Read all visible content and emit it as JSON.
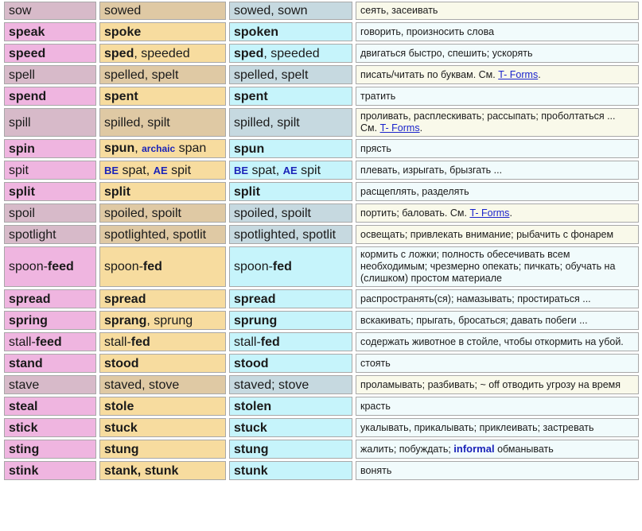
{
  "rows": [
    {
      "type": "weak",
      "h": 23,
      "base": [
        {
          "t": "sow"
        }
      ],
      "past": [
        {
          "t": "sowed"
        }
      ],
      "pp": [
        {
          "t": "sowed, sown"
        }
      ],
      "tr": [
        {
          "t": "сеять, засеивать"
        }
      ]
    },
    {
      "type": "strong",
      "h": 24,
      "base": [
        {
          "t": "speak",
          "b": true
        }
      ],
      "past": [
        {
          "t": "spoke",
          "b": true
        }
      ],
      "pp": [
        {
          "t": "spoken",
          "b": true
        }
      ],
      "tr": [
        {
          "t": "говорить, произносить слова"
        }
      ]
    },
    {
      "type": "strong",
      "h": 24,
      "base": [
        {
          "t": "speed",
          "b": true
        }
      ],
      "past": [
        {
          "t": "sped",
          "b": true
        },
        {
          "t": ", speeded"
        }
      ],
      "pp": [
        {
          "t": "sped",
          "b": true
        },
        {
          "t": ", speeded"
        }
      ],
      "tr": [
        {
          "t": "двигаться быстро, спешить; ускорять"
        }
      ]
    },
    {
      "type": "weak",
      "h": 24,
      "base": [
        {
          "t": "spell"
        }
      ],
      "past": [
        {
          "t": "spelled, spelt"
        }
      ],
      "pp": [
        {
          "t": "spelled, spelt"
        }
      ],
      "tr": [
        {
          "t": "писать/читать по буквам. См. "
        },
        {
          "t": "T- Forms",
          "link": true
        },
        {
          "t": "."
        }
      ]
    },
    {
      "type": "strong",
      "h": 24,
      "base": [
        {
          "t": "spend",
          "b": true
        }
      ],
      "past": [
        {
          "t": "spent",
          "b": true
        }
      ],
      "pp": [
        {
          "t": "spent",
          "b": true
        }
      ],
      "tr": [
        {
          "t": "тратить"
        }
      ]
    },
    {
      "type": "weak",
      "h": 34,
      "base": [
        {
          "t": "spill"
        }
      ],
      "past": [
        {
          "t": "spilled, spilt"
        }
      ],
      "pp": [
        {
          "t": "spilled, spilt"
        }
      ],
      "tr": [
        {
          "t": "проливать, расплескивать; рассыпать; проболтаться ... См. "
        },
        {
          "t": "T- Forms",
          "link": true
        },
        {
          "t": "."
        }
      ]
    },
    {
      "type": "strong",
      "h": 24,
      "base": [
        {
          "t": "spin",
          "b": true
        }
      ],
      "past": [
        {
          "t": "spun",
          "b": true
        },
        {
          "t": ", "
        },
        {
          "t": "archaic",
          "tag": true,
          "sm": true
        },
        {
          "t": " span"
        }
      ],
      "pp": [
        {
          "t": "spun",
          "b": true
        }
      ],
      "tr": [
        {
          "t": "прясть"
        }
      ]
    },
    {
      "type": "strong",
      "h": 24,
      "base": [
        {
          "t": "spit"
        }
      ],
      "past": [
        {
          "t": "BE",
          "tag": true
        },
        {
          "t": " spat, "
        },
        {
          "t": "AE",
          "tag": true
        },
        {
          "t": " spit"
        }
      ],
      "pp": [
        {
          "t": "BE",
          "tag": true
        },
        {
          "t": " spat, "
        },
        {
          "t": "AE",
          "tag": true
        },
        {
          "t": " spit"
        }
      ],
      "tr": [
        {
          "t": "плевать, изрыгать, брызгать ..."
        }
      ]
    },
    {
      "type": "strong",
      "h": 24,
      "base": [
        {
          "t": "split",
          "b": true
        }
      ],
      "past": [
        {
          "t": "split",
          "b": true
        }
      ],
      "pp": [
        {
          "t": "split",
          "b": true
        }
      ],
      "tr": [
        {
          "t": "расщеплять, разделять"
        }
      ]
    },
    {
      "type": "weak",
      "h": 24,
      "base": [
        {
          "t": "spoil"
        }
      ],
      "past": [
        {
          "t": "spoiled, spoilt"
        }
      ],
      "pp": [
        {
          "t": "spoiled, spoilt"
        }
      ],
      "tr": [
        {
          "t": "портить; баловать. См. "
        },
        {
          "t": "T- Forms",
          "link": true
        },
        {
          "t": "."
        }
      ]
    },
    {
      "type": "weak",
      "h": 24,
      "base": [
        {
          "t": "spotlight"
        }
      ],
      "past": [
        {
          "t": "spotlighted, spotlit"
        }
      ],
      "pp": [
        {
          "t": "spotlighted, spotlit"
        }
      ],
      "tr": [
        {
          "t": "освещать; привлекать внимание; рыбачить с фонарем"
        }
      ]
    },
    {
      "type": "strong",
      "h": 49,
      "base": [
        {
          "t": "spoon-"
        },
        {
          "t": "feed",
          "b": true
        }
      ],
      "past": [
        {
          "t": "spoon-"
        },
        {
          "t": "fed",
          "b": true
        }
      ],
      "pp": [
        {
          "t": "spoon-"
        },
        {
          "t": "fed",
          "b": true
        }
      ],
      "tr": [
        {
          "t": "кормить с ложки; полность обесечивать всем необходимым;  чрезмерно опекать; пичкать; обучать на (слишком) простом материале"
        }
      ]
    },
    {
      "type": "strong",
      "h": 24,
      "base": [
        {
          "t": "spread",
          "b": true
        }
      ],
      "past": [
        {
          "t": "spread",
          "b": true
        }
      ],
      "pp": [
        {
          "t": "spread",
          "b": true
        }
      ],
      "tr": [
        {
          "t": "распространять(ся); намазывать; простираться ..."
        }
      ]
    },
    {
      "type": "strong",
      "h": 24,
      "base": [
        {
          "t": "spring",
          "b": true
        }
      ],
      "past": [
        {
          "t": "sprang",
          "b": true
        },
        {
          "t": ", sprung"
        }
      ],
      "pp": [
        {
          "t": "sprung",
          "b": true
        }
      ],
      "tr": [
        {
          "t": "вскакивать; прыгать, бросаться; давать побеги ..."
        }
      ]
    },
    {
      "type": "strong",
      "h": 24,
      "base": [
        {
          "t": "stall-"
        },
        {
          "t": "feed",
          "b": true
        }
      ],
      "past": [
        {
          "t": "stall-"
        },
        {
          "t": "fed",
          "b": true
        }
      ],
      "pp": [
        {
          "t": "stall-"
        },
        {
          "t": "fed",
          "b": true
        }
      ],
      "tr": [
        {
          "t": "содержать животное в стойле, чтобы откормить на убой."
        }
      ]
    },
    {
      "type": "strong",
      "h": 24,
      "base": [
        {
          "t": "stand",
          "b": true
        }
      ],
      "past": [
        {
          "t": "stood",
          "b": true
        }
      ],
      "pp": [
        {
          "t": "stood",
          "b": true
        }
      ],
      "tr": [
        {
          "t": "стоять"
        }
      ]
    },
    {
      "type": "weak",
      "h": 24,
      "base": [
        {
          "t": "stave"
        }
      ],
      "past": [
        {
          "t": "staved, stove"
        }
      ],
      "pp": [
        {
          "t": "staved; stove"
        }
      ],
      "tr": [
        {
          "t": "проламывать; разбивать; ~ off отводить угрозу на время"
        }
      ]
    },
    {
      "type": "strong",
      "h": 24,
      "base": [
        {
          "t": "steal",
          "b": true
        }
      ],
      "past": [
        {
          "t": "stole",
          "b": true
        }
      ],
      "pp": [
        {
          "t": "stolen",
          "b": true
        }
      ],
      "tr": [
        {
          "t": "красть"
        }
      ]
    },
    {
      "type": "strong",
      "h": 24,
      "base": [
        {
          "t": "stick",
          "b": true
        }
      ],
      "past": [
        {
          "t": "stuck",
          "b": true
        }
      ],
      "pp": [
        {
          "t": "stuck",
          "b": true
        }
      ],
      "tr": [
        {
          "t": "укалывать, прикалывать; приклеивать; застревать"
        }
      ]
    },
    {
      "type": "strong",
      "h": 24,
      "base": [
        {
          "t": "sting",
          "b": true
        }
      ],
      "past": [
        {
          "t": "stung",
          "b": true
        }
      ],
      "pp": [
        {
          "t": "stung",
          "b": true
        }
      ],
      "tr": [
        {
          "t": "жалить; побуждать; "
        },
        {
          "t": "informal",
          "tag": true
        },
        {
          "t": " обманывать"
        }
      ]
    },
    {
      "type": "strong",
      "h": 24,
      "base": [
        {
          "t": "stink",
          "b": true
        }
      ],
      "past": [
        {
          "t": "stank, stunk",
          "b": true
        }
      ],
      "pp": [
        {
          "t": "stunk",
          "b": true
        }
      ],
      "tr": [
        {
          "t": "вонять"
        }
      ]
    }
  ]
}
